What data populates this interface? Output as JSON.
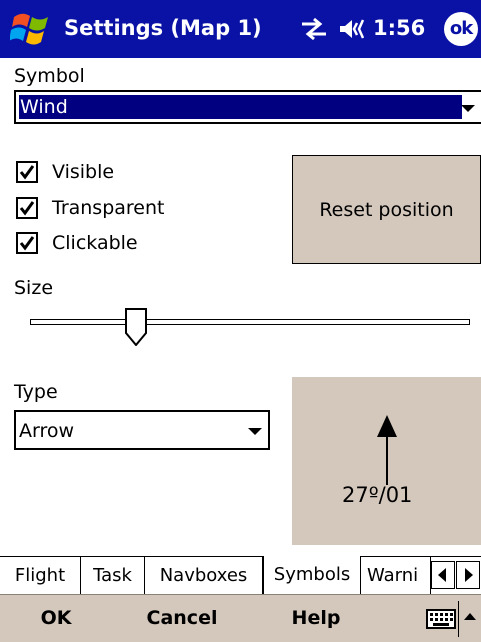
{
  "titlebar": {
    "title": "Settings (Map 1)",
    "clock": "1:56",
    "ok_label": "ok"
  },
  "symbol": {
    "label": "Symbol",
    "selected": "Wind"
  },
  "checkboxes": [
    {
      "label": "Visible",
      "checked": true
    },
    {
      "label": "Transparent",
      "checked": true
    },
    {
      "label": "Clickable",
      "checked": true
    }
  ],
  "reset_button_label": "Reset position",
  "size": {
    "label": "Size",
    "value_fraction": 0.24
  },
  "type": {
    "label": "Type",
    "selected": "Arrow"
  },
  "preview": {
    "wind_text": "27º/01"
  },
  "tabs": [
    {
      "label": "Flight",
      "active": false
    },
    {
      "label": "Task",
      "active": false
    },
    {
      "label": "Navboxes",
      "active": false
    },
    {
      "label": "Symbols",
      "active": true
    },
    {
      "label": "Warni",
      "active": false
    }
  ],
  "menubar": {
    "ok": "OK",
    "cancel": "Cancel",
    "help": "Help"
  },
  "icons": [
    "windows-start-icon",
    "connectivity-icon",
    "volume-icon",
    "keyboard-icon",
    "scroll-left-icon",
    "scroll-right-icon",
    "menu-up-icon"
  ],
  "colors": {
    "titlebar": "#0a12a6",
    "selection": "#000080",
    "button_face": "#d4c8bc"
  }
}
